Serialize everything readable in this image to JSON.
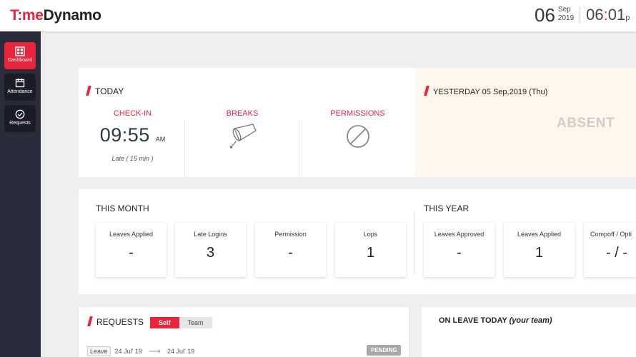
{
  "app": {
    "logo_part1": "T:me",
    "logo_part2": "Dynamo"
  },
  "header": {
    "day": "06",
    "month": "Sep",
    "year": "2019",
    "hour": "06",
    "minute": "01",
    "ampm": "p"
  },
  "sidebar": {
    "items": [
      {
        "label": "Dashboard",
        "icon": "grid-icon",
        "active": true
      },
      {
        "label": "Attendance",
        "icon": "calendar-icon",
        "active": false
      },
      {
        "label": "Requests",
        "icon": "check-circle-icon",
        "active": false
      }
    ]
  },
  "today": {
    "title": "TODAY",
    "checkin_label": "CHECK-IN",
    "checkin_time": "09:55",
    "checkin_ampm": "AM",
    "late_note": "Late ( 15 min )",
    "breaks_label": "BREAKS",
    "breaks_icon": "cup-icon",
    "permissions_label": "PERMISSIONS",
    "permissions_icon": "no-entry-icon"
  },
  "yesterday": {
    "title": "YESTERDAY 05 Sep,2019 (Thu)",
    "status": "ABSENT"
  },
  "this_month": {
    "title": "THIS MONTH",
    "stats": [
      {
        "label": "Leaves Applied",
        "value": "-"
      },
      {
        "label": "Late Logins",
        "value": "3"
      },
      {
        "label": "Permission",
        "value": "-"
      },
      {
        "label": "Lops",
        "value": "1"
      }
    ]
  },
  "this_year": {
    "title": "THIS YEAR",
    "stats": [
      {
        "label": "Leaves Approved",
        "value": "-"
      },
      {
        "label": "Leaves Applied",
        "value": "1"
      },
      {
        "label": "Compoff / Opti",
        "value": "- / -"
      }
    ]
  },
  "requests": {
    "title": "REQUESTS",
    "toggle_self": "Self",
    "toggle_team": "Team",
    "rows": [
      {
        "type": "Leave",
        "from": "24 Jul' 19",
        "to": "24 Jul' 19",
        "status": "PENDING"
      }
    ]
  },
  "on_leave": {
    "title_main": "ON LEAVE TODAY",
    "title_sub": "(your team)"
  },
  "colors": {
    "accent": "#e8253b",
    "sidebar_bg": "#2b2c3b",
    "yesterday_bg": "#fdf6ed"
  }
}
